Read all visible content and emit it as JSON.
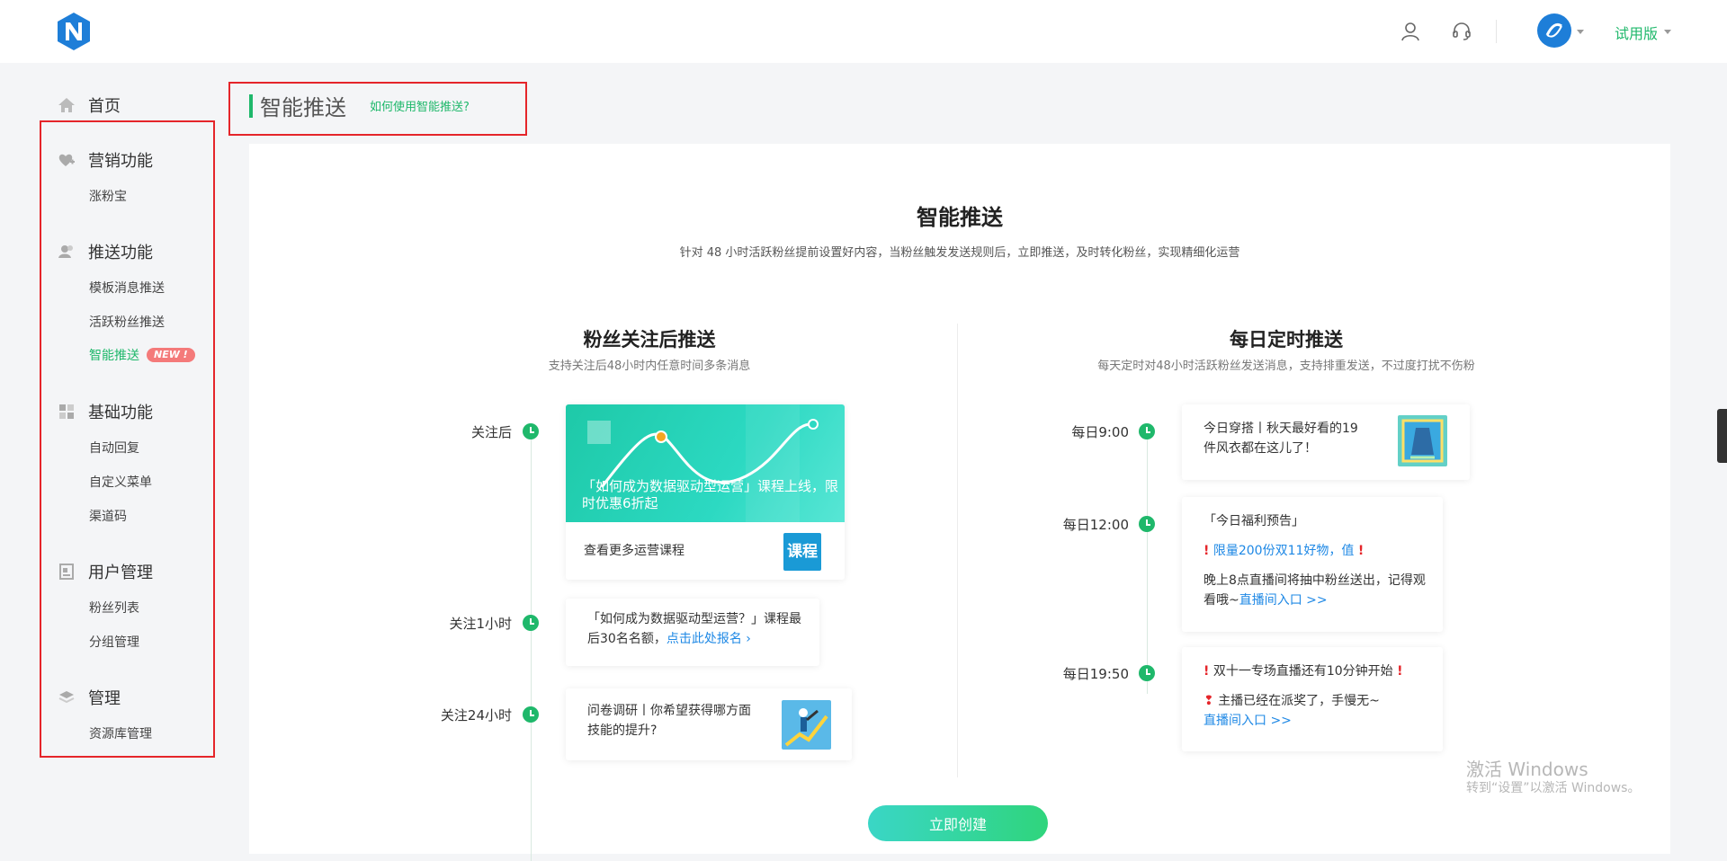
{
  "topbar": {
    "trial_label": "试用版"
  },
  "sidebar": {
    "home": "首页",
    "sections": [
      {
        "title": "营销功能",
        "items": [
          "涨粉宝"
        ]
      },
      {
        "title": "推送功能",
        "items": [
          "模板消息推送",
          "活跃粉丝推送",
          "智能推送"
        ]
      },
      {
        "title": "基础功能",
        "items": [
          "自动回复",
          "自定义菜单",
          "渠道码"
        ]
      },
      {
        "title": "用户管理",
        "items": [
          "粉丝列表",
          "分组管理"
        ]
      },
      {
        "title": "管理",
        "items": [
          "资源库管理"
        ]
      }
    ],
    "new_badge": "NEW !"
  },
  "page": {
    "title": "智能推送",
    "help_link": "如何使用智能推送?"
  },
  "main": {
    "title": "智能推送",
    "desc": "针对 48 小时活跃粉丝提前设置好内容，当粉丝触发发送规则后，立即推送，及时转化粉丝，实现精细化运营",
    "left": {
      "title": "粉丝关注后推送",
      "sub": "支持关注后48小时内任意时间多条消息",
      "items": [
        {
          "label": "关注后",
          "banner_text": "「如何成为数据驱动型运营」课程上线，限时优惠6折起",
          "footer_text": "查看更多运营课程",
          "thumb_text": "课程"
        },
        {
          "label": "关注1小时",
          "text": "「如何成为数据驱动型运营？」课程最后30名名额，",
          "link": "点击此处报名"
        },
        {
          "label": "关注24小时",
          "text": "问卷调研丨你希望获得哪方面技能的提升?"
        }
      ]
    },
    "right": {
      "title": "每日定时推送",
      "sub": "每天定时对48小时活跃粉丝发送消息，支持排重发送，不过度打扰不伤粉",
      "items": [
        {
          "label": "每日9:00",
          "text": "今日穿搭丨秋天最好看的19件风衣都在这儿了！"
        },
        {
          "label": "每日12:00",
          "line1": "「今日福利预告」",
          "line2": "限量200份双11好物，值",
          "line3": "晚上8点直播间将抽中粉丝送出，记得观看哦~",
          "link": "直播间入口 >>"
        },
        {
          "label": "每日19:50",
          "line1": "双十一专场直播还有10分钟开始",
          "line2": "主播已经在派奖了，手慢无~",
          "link": "直播间入口 >>"
        }
      ]
    },
    "create_button": "立即创建"
  },
  "watermark": {
    "line1": "激活 Windows",
    "line2": "转到“设置”以激活 Windows。"
  },
  "colors": {
    "accent": "#1fb86b",
    "link": "#1e88e5",
    "highlight_box": "#e5252a"
  }
}
